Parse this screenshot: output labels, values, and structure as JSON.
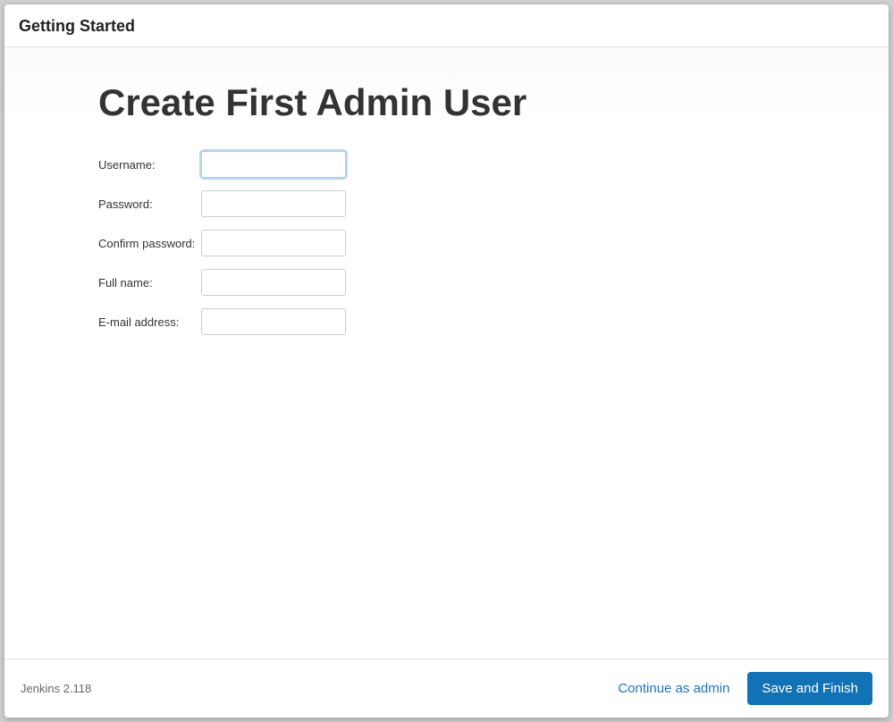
{
  "header": {
    "title": "Getting Started"
  },
  "page": {
    "title": "Create First Admin User"
  },
  "form": {
    "username": {
      "label": "Username:",
      "value": ""
    },
    "password": {
      "label": "Password:",
      "value": ""
    },
    "confirm_password": {
      "label": "Confirm password:",
      "value": ""
    },
    "full_name": {
      "label": "Full name:",
      "value": ""
    },
    "email": {
      "label": "E-mail address:",
      "value": ""
    }
  },
  "footer": {
    "version": "Jenkins 2.118",
    "continue_label": "Continue as admin",
    "save_label": "Save and Finish"
  }
}
